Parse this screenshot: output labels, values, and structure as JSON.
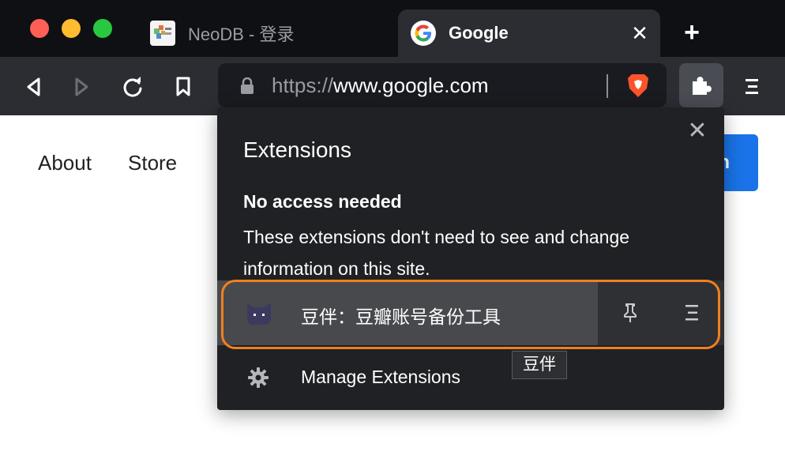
{
  "tabs": [
    {
      "title": "NeoDB - 登录",
      "favicon": "neodb-logo-icon",
      "active": false
    },
    {
      "title": "Google",
      "favicon": "google-g-icon",
      "active": true
    }
  ],
  "tab_close_glyph": "✕",
  "new_tab_glyph": "+",
  "toolbar": {
    "url_scheme": "https://",
    "url_host": "www.google.com"
  },
  "page": {
    "about_link": "About",
    "store_link": "Store",
    "signin_partial": "n"
  },
  "extensions_popup": {
    "title": "Extensions",
    "close_glyph": "✕",
    "section_heading": "No access needed",
    "section_description": "These extensions don't need to see and change information on this site.",
    "extension": {
      "name": "豆伴：豆瓣账号备份工具",
      "icon": "cat-ears-icon"
    },
    "manage_label": "Manage Extensions",
    "tooltip": "豆伴"
  },
  "colors": {
    "highlight": "#f0801e",
    "google_blue": "#1a73e8",
    "brave_orange": "#fb542b"
  }
}
